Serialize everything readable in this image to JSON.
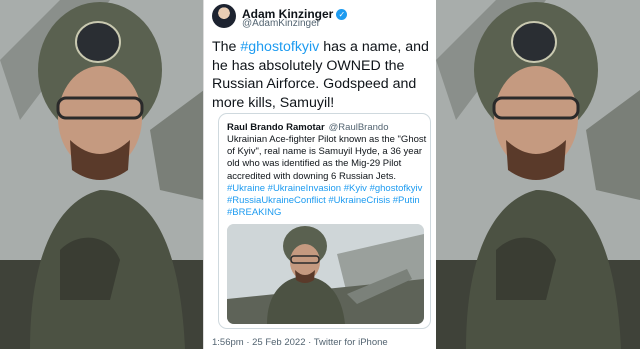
{
  "tweet": {
    "author_name": "Adam Kinzinger",
    "author_handle": "@AdamKinzinger",
    "text_part1": "The ",
    "hashtag1": "#ghostofkyiv",
    "text_part2": " has a name, and he has absolutely OWNED the Russian Airforce.  Godspeed and more kills, Samuyil!",
    "timestamp": "1:56pm · 25 Feb 2022 · Twitter for iPhone"
  },
  "quoted": {
    "author_name": "Raul Brando Ramotar",
    "author_handle": "@RaulBrando",
    "text": "Ukrainian Ace-fighter Pilot known as the \"Ghost of Kyiv\", real name is Samuyil Hyde, a 36 year old who was identified as the Mig-29 Pilot accredited with downing 6 Russian Jets. ",
    "hashtags": "#Ukraine #UkraineInvasion #Kyiv #ghostofkyiv #RussiaUkraineConflict #UkraineCrisis #Putin #BREAKING"
  },
  "icons": {
    "verified": "verified-badge-icon"
  },
  "colors": {
    "link": "#1d9bf0",
    "text": "#0f1419",
    "muted": "#536471"
  }
}
